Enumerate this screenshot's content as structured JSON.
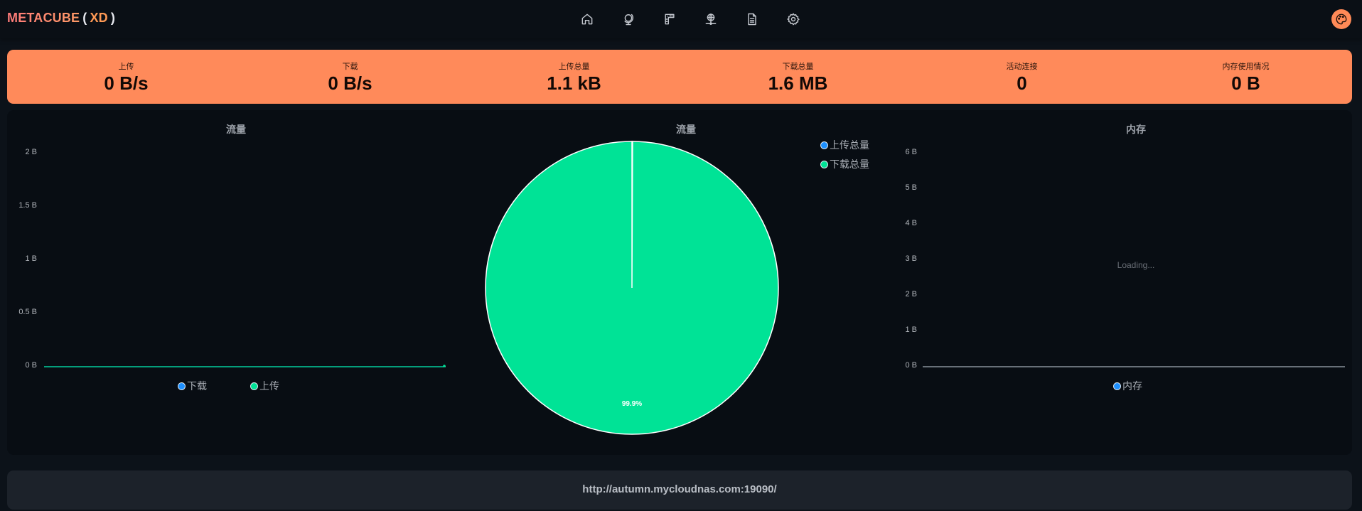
{
  "brand": {
    "name": "METACUBE",
    "open_paren": "(",
    "suffix": "XD",
    "close_paren": ")"
  },
  "nav": {
    "items": [
      {
        "icon": "home-icon",
        "label": ""
      },
      {
        "icon": "globe-icon",
        "label": ""
      },
      {
        "icon": "rules-icon",
        "label": ""
      },
      {
        "icon": "network-icon",
        "label": ""
      },
      {
        "icon": "logs-icon",
        "label": ""
      },
      {
        "icon": "gear-icon",
        "label": ""
      }
    ],
    "theme_icon": "palette-icon"
  },
  "colors": {
    "accent": "#ff8a5a",
    "download": "#1e90ff",
    "upload": "#00e396",
    "background": "#0c1219"
  },
  "stats": [
    {
      "label": "上传",
      "value": "0 B/s"
    },
    {
      "label": "下载",
      "value": "0 B/s"
    },
    {
      "label": "上传总量",
      "value": "1.1 kB"
    },
    {
      "label": "下载总量",
      "value": "1.6 MB"
    },
    {
      "label": "活动连接",
      "value": "0"
    },
    {
      "label": "内存使用情况",
      "value": "0 B"
    }
  ],
  "chart_data": [
    {
      "type": "line",
      "title": "流量",
      "y_ticks": [
        "2 B",
        "1.5 B",
        "1 B",
        "0.5 B",
        "0 B"
      ],
      "ylim": [
        0,
        2
      ],
      "series": [
        {
          "name": "下载",
          "values": [
            0,
            0,
            0
          ]
        },
        {
          "name": "上传",
          "values": [
            0,
            0,
            0
          ]
        }
      ],
      "legend": "bottom"
    },
    {
      "type": "pie",
      "title": "流量",
      "series": [
        {
          "name": "上传总量",
          "value": 1.1,
          "unit": "kB"
        },
        {
          "name": "下载总量",
          "value": 1600,
          "unit": "kB"
        }
      ],
      "slice_label": "99.9%",
      "legend": "top-right"
    },
    {
      "type": "line",
      "title": "内存",
      "y_ticks": [
        "6 B",
        "5 B",
        "4 B",
        "3 B",
        "2 B",
        "1 B",
        "0 B"
      ],
      "ylim": [
        0,
        6
      ],
      "series": [
        {
          "name": "内存",
          "values": []
        }
      ],
      "status": "Loading...",
      "legend": "bottom"
    }
  ],
  "footer": {
    "url": "http://autumn.mycloudnas.com:19090/"
  }
}
